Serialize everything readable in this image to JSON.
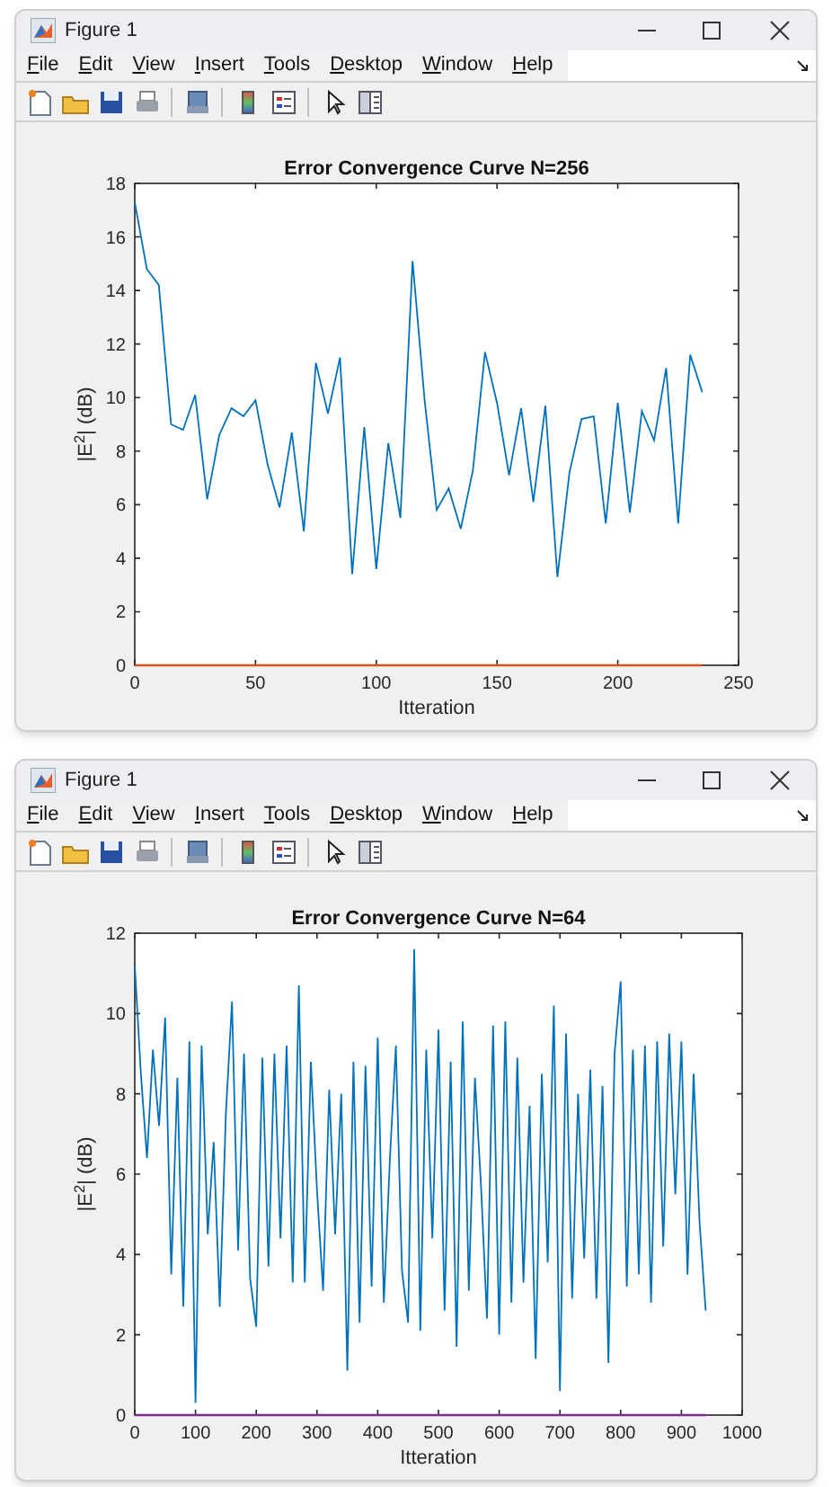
{
  "figures": [
    {
      "title": "Figure 1",
      "menu": [
        "File",
        "Edit",
        "View",
        "Insert",
        "Tools",
        "Desktop",
        "Window",
        "Help"
      ],
      "chart_data": {
        "type": "line",
        "title": "Error Convergence Curve N=256",
        "xlabel": "Itteration",
        "ylabel": "|E$^{2}$| (dB)",
        "xlim": [
          0,
          250
        ],
        "ylim": [
          0,
          18
        ],
        "xticks": [
          0,
          50,
          100,
          150,
          200,
          250
        ],
        "yticks": [
          0,
          2,
          4,
          6,
          8,
          10,
          12,
          14,
          16,
          18
        ],
        "x": [
          0,
          5,
          10,
          15,
          20,
          25,
          30,
          35,
          40,
          45,
          50,
          55,
          60,
          65,
          70,
          75,
          80,
          85,
          90,
          95,
          100,
          105,
          110,
          115,
          120,
          125,
          130,
          135,
          140,
          145,
          150,
          155,
          160,
          165,
          170,
          175,
          180,
          185,
          190,
          195,
          200,
          205,
          210,
          215,
          220,
          225,
          230,
          235
        ],
        "series": [
          {
            "color": "#0072bd",
            "values": [
              17.3,
              14.8,
              14.2,
              9,
              8.8,
              10.1,
              6.2,
              8.6,
              9.6,
              9.3,
              9.9,
              7.5,
              5.9,
              8.7,
              5,
              11.3,
              9.4,
              11.5,
              3.4,
              8.9,
              3.6,
              8.3,
              5.5,
              15.1,
              9.9,
              5.8,
              6.6,
              5.1,
              7.3,
              11.7,
              9.8,
              7.1,
              9.6,
              6.1,
              9.7,
              3.3,
              7.2,
              9.2,
              9.3,
              5.3,
              9.8,
              5.7,
              9.5,
              8.4,
              11.1,
              5.3,
              11.6,
              10.2
            ]
          },
          {
            "color": "#d95319",
            "values": [
              0,
              0,
              0,
              0,
              0,
              0,
              0,
              0,
              0,
              0,
              0,
              0,
              0,
              0,
              0,
              0,
              0,
              0,
              0,
              0,
              0,
              0,
              0,
              0,
              0,
              0,
              0,
              0,
              0,
              0,
              0,
              0,
              0,
              0,
              0,
              0,
              0,
              0,
              0,
              0,
              0,
              0,
              0,
              0,
              0,
              0,
              0,
              0
            ]
          }
        ]
      }
    },
    {
      "title": "Figure 1",
      "menu": [
        "File",
        "Edit",
        "View",
        "Insert",
        "Tools",
        "Desktop",
        "Window",
        "Help"
      ],
      "chart_data": {
        "type": "line",
        "title": "Error Convergence Curve N=64",
        "xlabel": "Itteration",
        "ylabel": "|E$^{2}$| (dB)",
        "xlim": [
          0,
          1000
        ],
        "ylim": [
          0,
          12
        ],
        "xticks": [
          0,
          100,
          200,
          300,
          400,
          500,
          600,
          700,
          800,
          900,
          1000
        ],
        "yticks": [
          0,
          2,
          4,
          6,
          8,
          10,
          12
        ],
        "x": [
          0,
          10,
          20,
          30,
          40,
          50,
          60,
          70,
          80,
          90,
          100,
          110,
          120,
          130,
          140,
          150,
          160,
          170,
          180,
          190,
          200,
          210,
          220,
          230,
          240,
          250,
          260,
          270,
          280,
          290,
          300,
          310,
          320,
          330,
          340,
          350,
          360,
          370,
          380,
          390,
          400,
          410,
          420,
          430,
          440,
          450,
          460,
          470,
          480,
          490,
          500,
          510,
          520,
          530,
          540,
          550,
          560,
          570,
          580,
          590,
          600,
          610,
          620,
          630,
          640,
          650,
          660,
          670,
          680,
          690,
          700,
          710,
          720,
          730,
          740,
          750,
          760,
          770,
          780,
          790,
          800,
          810,
          820,
          830,
          840,
          850,
          860,
          870,
          880,
          890,
          900,
          910,
          920,
          930,
          940
        ],
        "series": [
          {
            "color": "#0072bd",
            "values": [
              11.2,
              8.5,
              6.4,
              9.1,
              7.2,
              9.9,
              3.5,
              8.4,
              2.7,
              9.3,
              0.3,
              9.2,
              4.5,
              6.8,
              2.7,
              7.5,
              10.3,
              4.1,
              9,
              3.4,
              2.2,
              8.9,
              3.7,
              9,
              4.4,
              9.2,
              3.3,
              10.7,
              3.3,
              8.8,
              5.6,
              3.1,
              8.1,
              4.5,
              8,
              1.1,
              8.8,
              2.3,
              8.7,
              3.2,
              9.4,
              2.8,
              6.4,
              9.2,
              3.6,
              2.3,
              11.6,
              2.1,
              9.1,
              4.4,
              9.6,
              2.6,
              8.8,
              1.7,
              9.8,
              3.1,
              8.4,
              5.7,
              2.4,
              9.7,
              2,
              9.8,
              2.8,
              8.9,
              3.3,
              7.7,
              1.4,
              8.5,
              3.8,
              10.2,
              0.6,
              9.5,
              2.9,
              8,
              3.9,
              8.6,
              2.9,
              8.2,
              1.3,
              9,
              10.8,
              3.2,
              9.1,
              3.5,
              9.2,
              2.8,
              9.3,
              4.2,
              9.5,
              5.5,
              9.3,
              3.5,
              8.5,
              4.8,
              2.6
            ]
          },
          {
            "color": "#7e2f8e",
            "values": [
              0,
              0,
              0,
              0,
              0,
              0,
              0,
              0,
              0,
              0,
              0,
              0,
              0,
              0,
              0,
              0,
              0,
              0,
              0,
              0,
              0,
              0,
              0,
              0,
              0,
              0,
              0,
              0,
              0,
              0,
              0,
              0,
              0,
              0,
              0,
              0,
              0,
              0,
              0,
              0,
              0,
              0,
              0,
              0,
              0,
              0,
              0,
              0,
              0,
              0,
              0,
              0,
              0,
              0,
              0,
              0,
              0,
              0,
              0,
              0,
              0,
              0,
              0,
              0,
              0,
              0,
              0,
              0,
              0,
              0,
              0,
              0,
              0,
              0,
              0,
              0,
              0,
              0,
              0,
              0,
              0,
              0,
              0,
              0,
              0,
              0,
              0,
              0,
              0,
              0,
              0,
              0,
              0,
              0,
              0
            ]
          }
        ]
      }
    }
  ]
}
